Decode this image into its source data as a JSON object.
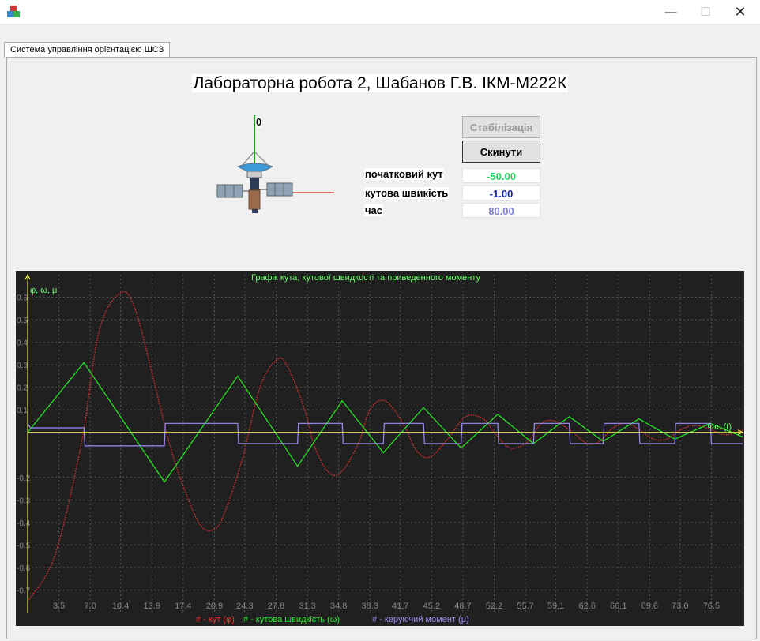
{
  "window": {
    "min_glyph": "—",
    "max_glyph": "☐",
    "close_glyph": "✕"
  },
  "tab": {
    "label": "Система управління орієнтацією ШСЗ"
  },
  "header": {
    "title": "Лабораторна робота 2, Шабанов Г.В. ІКМ-М222К"
  },
  "satellite": {
    "angle_label": "0"
  },
  "controls": {
    "stabilize_label": "Стабілізація",
    "reset_label": "Скинути",
    "initial_angle_label": "початковий кут",
    "initial_angle_value": "-50.00",
    "angular_velocity_label": "кутова швикість",
    "angular_velocity_value": "-1.00",
    "time_label": "час",
    "time_value": "80.00"
  },
  "colors": {
    "angle": "#ff3030",
    "velocity": "#22ee22",
    "moment": "#9d8df8",
    "axes": "#ffff55",
    "chart_bg": "#202020",
    "grid": "#555555"
  },
  "chart_data": {
    "type": "line",
    "title": "Графік кута, кутової швидкості та приведенного моменту",
    "ylabel": "φ, ω, μ",
    "xlabel": "час (t)",
    "xlim": [
      0,
      80
    ],
    "ylim": [
      -0.8,
      0.7
    ],
    "x_ticks": [
      "3.5",
      "7.0",
      "10.4",
      "13.9",
      "17.4",
      "20.9",
      "24.3",
      "27.8",
      "31.3",
      "34.8",
      "38.3",
      "41.7",
      "45.2",
      "48.7",
      "52.2",
      "55.7",
      "59.1",
      "62.6",
      "66.1",
      "69.6",
      "73.0",
      "76.5"
    ],
    "x_tick_values": [
      3.5,
      7.0,
      10.4,
      13.9,
      17.4,
      20.9,
      24.3,
      27.8,
      31.3,
      34.8,
      38.3,
      41.7,
      45.2,
      48.7,
      52.2,
      55.7,
      59.1,
      62.6,
      66.1,
      69.6,
      73.0,
      76.5
    ],
    "y_ticks": [
      "0.6",
      "0.5",
      "0.4",
      "0.3",
      "0.2",
      "0.1",
      "-0.2",
      "-0.3",
      "-0.4",
      "-0.5",
      "-0.6",
      "-0.7"
    ],
    "y_tick_values": [
      0.6,
      0.5,
      0.4,
      0.3,
      0.2,
      0.1,
      -0.2,
      -0.3,
      -0.4,
      -0.5,
      -0.6,
      -0.7
    ],
    "series": [
      {
        "name": "# - кут (φ)",
        "style": "dotted",
        "x": [
          0,
          3,
          6,
          8,
          10.4,
          12,
          14,
          16,
          18,
          19.5,
          20.9,
          22,
          24,
          26,
          27.8,
          29,
          31,
          32,
          33.5,
          35,
          37,
          38.3,
          40,
          42,
          43.5,
          45,
          47,
          49,
          51,
          52.2,
          54,
          56,
          57.5,
          59,
          61,
          62.6,
          64,
          65.5,
          67,
          68.5,
          70,
          71.5,
          73,
          74.5,
          76,
          78,
          80
        ],
        "y": [
          -0.75,
          -0.55,
          -0.05,
          0.45,
          0.62,
          0.55,
          0.25,
          -0.07,
          -0.3,
          -0.42,
          -0.43,
          -0.36,
          -0.12,
          0.2,
          0.32,
          0.3,
          0.1,
          -0.05,
          -0.17,
          -0.18,
          -0.05,
          0.1,
          0.14,
          0.04,
          -0.08,
          -0.11,
          -0.03,
          0.07,
          0.06,
          0.0,
          -0.07,
          -0.04,
          0.04,
          0.05,
          0.0,
          -0.05,
          -0.04,
          0.02,
          0.04,
          0.01,
          -0.03,
          -0.03,
          0.01,
          0.03,
          0.02,
          -0.01,
          0.01
        ]
      },
      {
        "name": "# - кутова швидкість (ω)",
        "style": "solid",
        "x": [
          0,
          6.3,
          15.3,
          23.5,
          30.2,
          35.2,
          39.8,
          44.3,
          48.5,
          52.6,
          56.6,
          60.6,
          64.4,
          68.4,
          72.4,
          76.4,
          80
        ],
        "y": [
          0,
          0.31,
          -0.22,
          0.25,
          -0.15,
          0.14,
          -0.09,
          0.11,
          -0.07,
          0.08,
          -0.05,
          0.07,
          -0.04,
          0.06,
          -0.03,
          0.04,
          -0.02
        ]
      },
      {
        "name": "# - керуючий момент (μ)",
        "style": "steps",
        "x": [
          0,
          0.3,
          6.3,
          6.4,
          15.3,
          15.4,
          23.5,
          23.6,
          30.2,
          30.3,
          35.2,
          35.3,
          39.8,
          39.9,
          44.3,
          44.4,
          48.5,
          48.6,
          52.6,
          52.7,
          56.6,
          56.7,
          60.6,
          60.7,
          64.4,
          64.5,
          68.4,
          68.5,
          72.4,
          72.5,
          76.4,
          76.5,
          80
        ],
        "y": [
          0.04,
          0.02,
          0.02,
          -0.06,
          -0.06,
          0.04,
          0.04,
          -0.05,
          -0.05,
          0.04,
          0.04,
          -0.05,
          -0.05,
          0.04,
          0.04,
          -0.05,
          -0.05,
          0.04,
          0.04,
          -0.05,
          -0.05,
          0.04,
          0.04,
          -0.05,
          -0.05,
          0.04,
          0.04,
          -0.05,
          -0.05,
          0.04,
          0.04,
          -0.05,
          -0.05
        ]
      }
    ]
  }
}
